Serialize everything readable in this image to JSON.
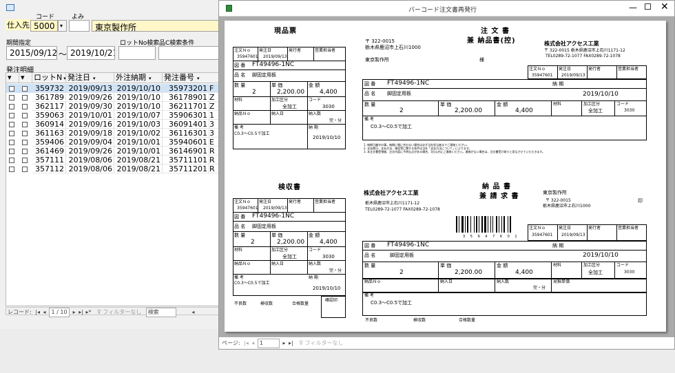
{
  "left": {
    "supplier_label": "仕入先",
    "code_label": "コード",
    "yomi_label": "よみ",
    "supplier_code": "5000",
    "supplier_name": "東京製作所",
    "period_label": "期間指定",
    "date_from": "2015/09/12",
    "date_sep": "～",
    "date_to": "2019/10/21",
    "lot_search_label": "ロットNo検索",
    "code_search_label": "品C検索条件",
    "section_label": "発注明細",
    "columns": [
      "ロットN",
      "発注日",
      "外注納期",
      "発注番号"
    ],
    "rows": [
      {
        "lot": "359732",
        "date": "2019/09/13",
        "due": "2019/10/10",
        "order": "35973201",
        "extra": "F"
      },
      {
        "lot": "361789",
        "date": "2019/09/26",
        "due": "2019/10/10",
        "order": "36178901",
        "extra": "Z"
      },
      {
        "lot": "362117",
        "date": "2019/09/30",
        "due": "2019/10/10",
        "order": "36211701",
        "extra": "Z"
      },
      {
        "lot": "359063",
        "date": "2019/10/01",
        "due": "2019/10/07",
        "order": "35906301",
        "extra": "1"
      },
      {
        "lot": "360914",
        "date": "2019/09/16",
        "due": "2019/10/03",
        "order": "36091401",
        "extra": "3"
      },
      {
        "lot": "361163",
        "date": "2019/09/18",
        "due": "2019/10/02",
        "order": "36116301",
        "extra": "3"
      },
      {
        "lot": "359406",
        "date": "2019/09/04",
        "due": "2019/10/01",
        "order": "35940601",
        "extra": "E"
      },
      {
        "lot": "361469",
        "date": "2019/09/26",
        "due": "2019/10/01",
        "order": "36146901",
        "extra": "R"
      },
      {
        "lot": "357111",
        "date": "2019/08/06",
        "due": "2019/08/21",
        "order": "35711101",
        "extra": "R"
      },
      {
        "lot": "357112",
        "date": "2019/08/06",
        "due": "2019/08/21",
        "order": "35711201",
        "extra": "R"
      }
    ],
    "nav": {
      "record_label": "レコード:",
      "position": "1 / 10",
      "filter": "フィルターなし",
      "search": "検索"
    }
  },
  "report": {
    "window_title": "バーコード注文書再発行",
    "nav": {
      "page_label": "ページ:",
      "page": "1",
      "filter": "フィルターなし"
    },
    "doc": {
      "genpin_title": "現品票",
      "kenshu_title": "検収書",
      "order_title_1": "注 文 書",
      "order_title_2": "兼 納品書(控)",
      "deliv_title_1": "納 品 書",
      "deliv_title_2": "兼 請 求 書",
      "to_zip": "〒 322-0015",
      "to_addr": "栃木県鹿沼市上石川1000",
      "to_name": "東京製作所",
      "sama": "様",
      "from_name": "株式会社アクセス工業",
      "from_zip": "〒 322-0015 栃木県鹿沼市上石川1171-12",
      "from_tel": "TEL0289-72-1077 FAX0289-72-1078",
      "deliv_addr": "栃木県鹿沼市上石川1171-12",
      "deliv_tel": "TEL0289-72-1077 FAX0289-72-1078",
      "deliv_zip": "〒 322-0015",
      "deliv_to_addr": "栃木県鹿沼市上石川1000",
      "stamp": "印",
      "order_no_label": "注文Ｎｏ",
      "order_date_label": "発注日",
      "issuer_label": "発行者",
      "manager_label": "営業担当者",
      "order_no": "35947601",
      "order_date": "2019/09/13",
      "zuban_label": "図 番",
      "zuban": "FT49496-1NC",
      "hinmei_label": "品 名",
      "hinmei": "脚固定用板",
      "nouki_label": "納 期",
      "nouki": "2019/10/10",
      "qty_label": "数 量",
      "qty": "2",
      "price_label": "単 価",
      "price": "2,200.00",
      "amount_label": "金 額",
      "amount": "4,400",
      "zairyo_label": "材料",
      "kakou_label": "加工区分",
      "kakou": "全加工",
      "code_label": "コード",
      "code": "3030",
      "nohin_no_label": "納品Ｎｏ",
      "nyuka_label": "納入日",
      "nyuka_qty_label": "納入数",
      "kanfun": "完・分",
      "biko_label": "備 考",
      "biko": "C0.3～C0.5で加工",
      "furyo_label": "不良数",
      "kenshu_label": "検収数",
      "goukaku_label": "合格数量",
      "kakunin_label": "確認印",
      "kenshu_tanka_label": "見積単価",
      "barcode_digits": "3 5 9 4 7 6 0 1",
      "note1": "1. 納期日厳守の事。納期に間に合わない場合は必ず当社担当者までご連絡ください。",
      "note2": "2. 支払期日、支払方法、検収等に関する条件は当社「支払方法について」によります。",
      "note3": "3. 本注文書受領後、注文内容に不明な点がある場合、3日以内にご連絡ください。連絡がない場合は、注文書受け取りと見なさせていただきます。"
    }
  }
}
